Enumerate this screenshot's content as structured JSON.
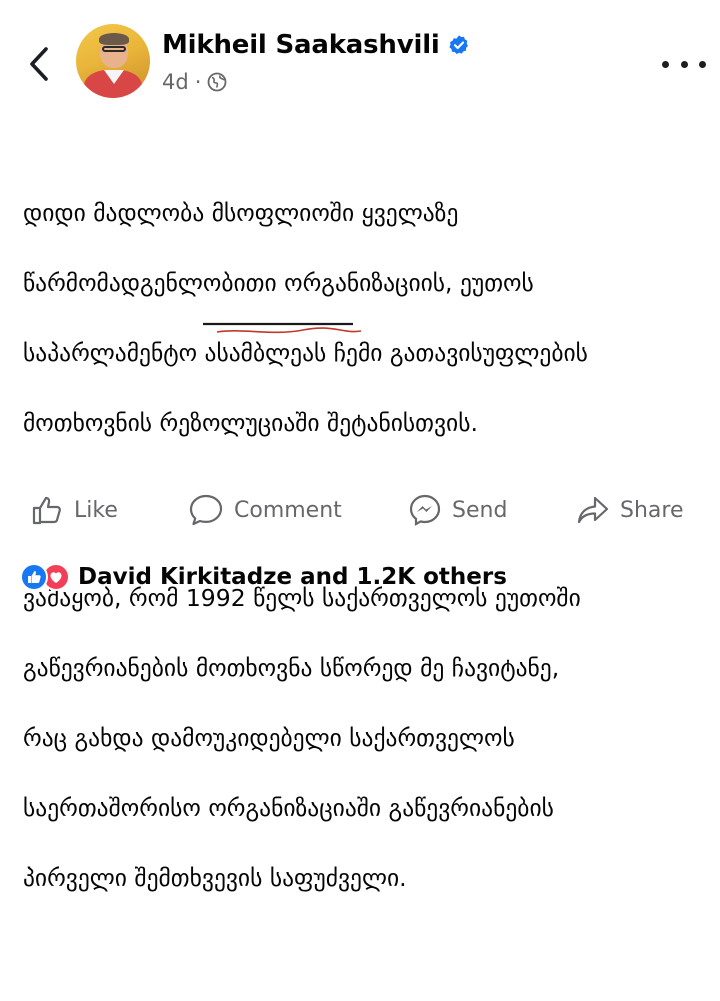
{
  "header": {
    "author_name": "Mikheil Saakashvili",
    "verified": true,
    "time_ago": "4d",
    "separator": "·",
    "audience_icon": "globe-icon",
    "back_icon": "chevron-left-icon",
    "more_icon": "more-horizontal-icon"
  },
  "post": {
    "paragraphs": [
      {
        "lines": [
          "დიდი მადლობა მსოფლიოში ყველაზე",
          "წარმომადგენლობითი ორგანიზაციის, ეუთოს",
          "საპარლამენტო ასამბლეას ჩემი გათავისუფლების",
          "მოთხოვნის რეზოლუციაში შეტანისთვის."
        ]
      },
      {
        "lines": [
          "ვამაყობ, რომ 1992 წელს საქართველოს ეუთოში",
          "გაწევრიანების მოთხოვნა სწორედ მე ჩავიტანე,",
          "რაც გახდა დამოუკიდებელი საქართველოს",
          "საერთაშორისო ორგანიზაციაში გაწევრიანების",
          "პირველი შემთხვევის საფუძველი."
        ]
      }
    ]
  },
  "actions": {
    "like": {
      "label": "Like",
      "icon": "thumbs-up-icon"
    },
    "comment": {
      "label": "Comment",
      "icon": "comment-icon"
    },
    "send": {
      "label": "Send",
      "icon": "messenger-icon"
    },
    "share": {
      "label": "Share",
      "icon": "share-icon"
    }
  },
  "reactions": {
    "icons": [
      "like-reaction-icon",
      "love-reaction-icon"
    ],
    "summary": "David Kirkitadze and 1.2K others"
  },
  "colors": {
    "text": "#050505",
    "secondary": "#65676b",
    "facebook_blue": "#1877f2",
    "love_red": "#f33e58",
    "underline_ink": "#1a1a1a",
    "annotation_red": "#c0392b"
  }
}
